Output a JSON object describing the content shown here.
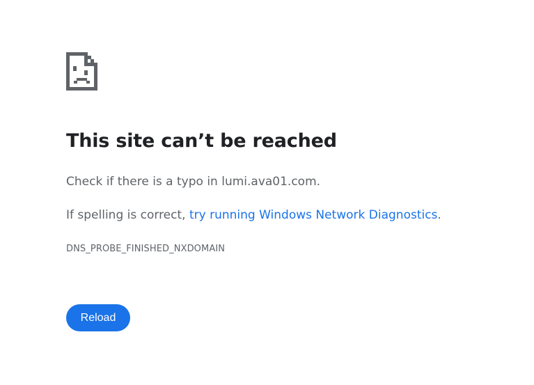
{
  "error_page": {
    "icon": "sad-document-icon",
    "title": "This site can’t be reached",
    "message_prefix": "Check if there is a typo in ",
    "domain": "lumi.ava01.com",
    "message_suffix": ".",
    "spelling_prefix": "If spelling is correct, ",
    "diagnostics_link": "try running Windows Network Diagnostics",
    "spelling_suffix": ".",
    "error_code": "DNS_PROBE_FINISHED_NXDOMAIN",
    "reload_label": "Reload"
  },
  "colors": {
    "accent": "#1a73e8",
    "title_text": "#202124",
    "body_text": "#5f6368",
    "icon": "#5f6368"
  }
}
